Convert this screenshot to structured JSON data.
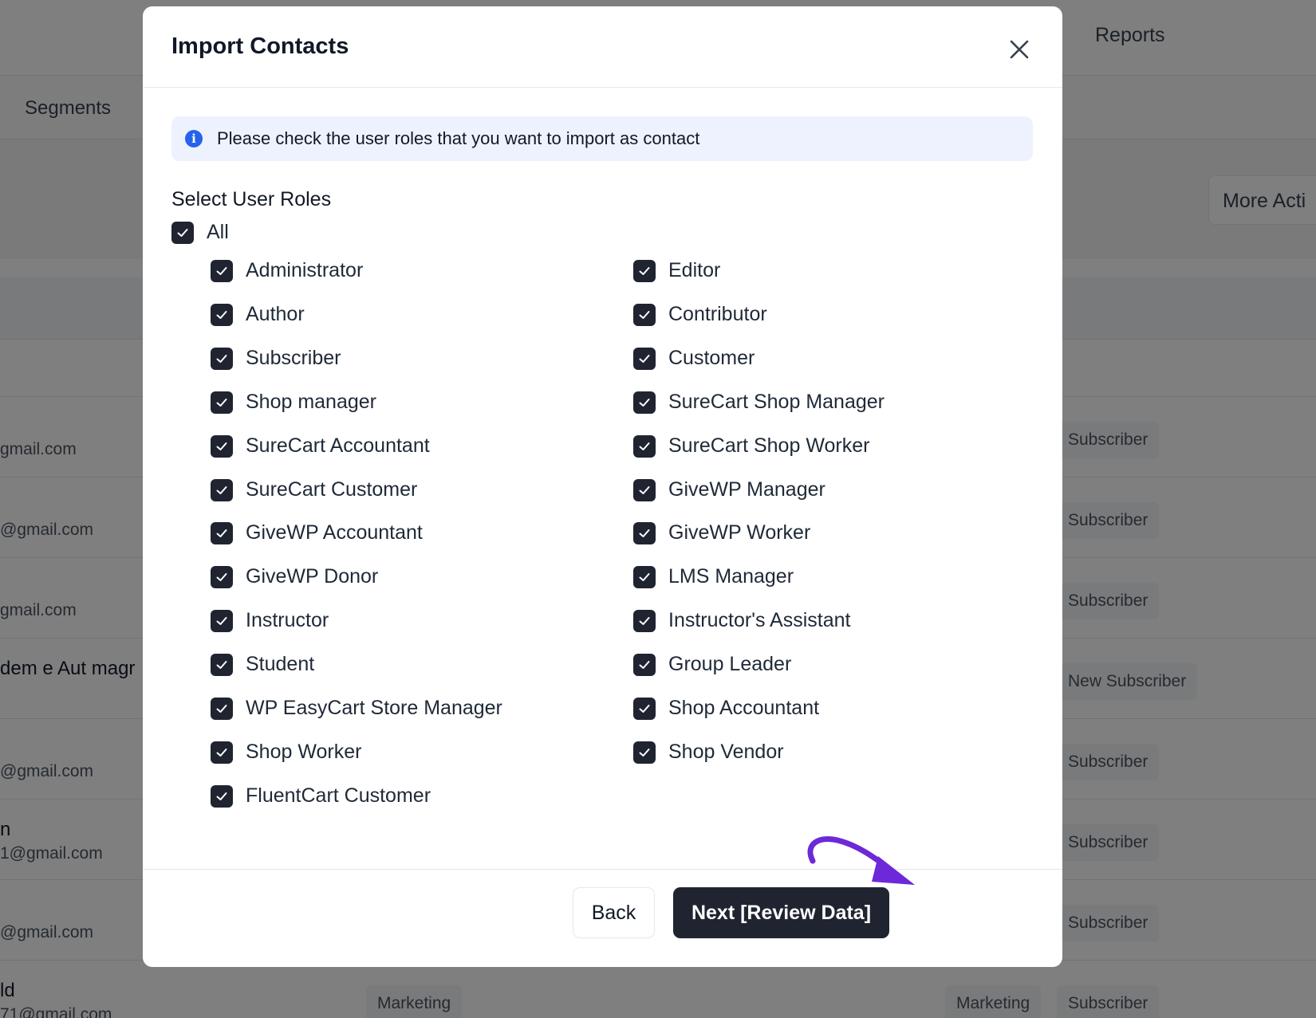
{
  "background": {
    "reports_tab": "Reports",
    "segments_tab": "Segments",
    "more_actions": "More Acti",
    "rows": [
      {
        "name": "",
        "email": "gmail.com",
        "tags": [
          "Subscriber"
        ]
      },
      {
        "name": "",
        "email": "@gmail.com",
        "tags": [
          "Subscriber"
        ]
      },
      {
        "name": "",
        "email": "gmail.com",
        "tags": [
          "Subscriber"
        ]
      },
      {
        "name": "dem e Aut magr",
        "email": "",
        "tags": [
          "New Subscriber"
        ]
      },
      {
        "name": "",
        "email": "@gmail.com",
        "tags": [
          "Subscriber"
        ]
      },
      {
        "name": "n",
        "email": "1@gmail.com",
        "tags": [
          "Subscriber"
        ]
      },
      {
        "name": "",
        "email": "@gmail.com",
        "tags": [
          "Subscriber"
        ]
      },
      {
        "name": "ld",
        "email": "71@gmail.com",
        "tags": [
          "Marketing",
          "Marketing",
          "Subscriber"
        ]
      }
    ]
  },
  "modal": {
    "title": "Import Contacts",
    "info_text": "Please check the user roles that you want to import as contact",
    "section_label": "Select User Roles",
    "all_label": "All",
    "all_checked": true,
    "roles_left": [
      "Administrator",
      "Author",
      "Subscriber",
      "Shop manager",
      "SureCart Accountant",
      "SureCart Customer",
      "GiveWP Accountant",
      "GiveWP Donor",
      "Instructor",
      "Student",
      "WP EasyCart Store Manager",
      "Shop Worker",
      "FluentCart Customer"
    ],
    "roles_right": [
      "Editor",
      "Contributor",
      "Customer",
      "SureCart Shop Manager",
      "SureCart Shop Worker",
      "GiveWP Manager",
      "GiveWP Worker",
      "LMS Manager",
      "Instructor's Assistant",
      "Group Leader",
      "Shop Accountant",
      "Shop Vendor"
    ],
    "back_label": "Back",
    "next_label": "Next [Review Data]"
  },
  "colors": {
    "checkbox": "#1f2430",
    "primary_button": "#1f2430",
    "info_bg": "#eef2ff",
    "info_icon": "#2563eb",
    "annotation_arrow": "#6d28d9"
  }
}
